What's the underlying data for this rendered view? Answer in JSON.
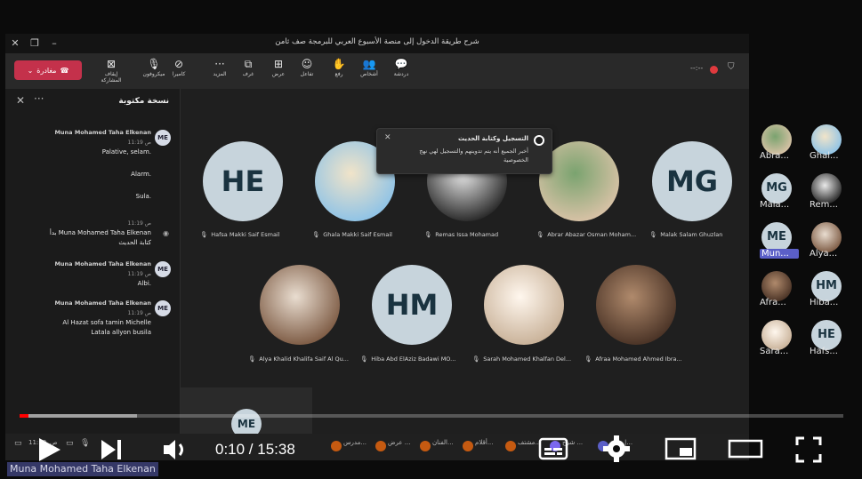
{
  "window": {
    "title": "شرح طريقة الدخول إلى منصة الأسبوع العربي للبرمجة صف ثامن"
  },
  "toolbar": {
    "leave_label": "مغادرة",
    "items": [
      {
        "label": "إيقاف المشاركة",
        "icon": "share-stop-icon"
      },
      {
        "label": "ميكروفون",
        "icon": "mic-icon"
      },
      {
        "label": "كاميرا",
        "icon": "camera-off-icon"
      },
      {
        "label": "المزيد",
        "icon": "more-icon"
      },
      {
        "label": "غرف",
        "icon": "rooms-icon"
      },
      {
        "label": "عرض",
        "icon": "view-icon"
      },
      {
        "label": "تفاعل",
        "icon": "react-icon"
      },
      {
        "label": "رفع",
        "icon": "raise-hand-icon"
      },
      {
        "label": "أشخاص",
        "icon": "people-icon"
      },
      {
        "label": "دردشة",
        "icon": "chat-icon"
      }
    ],
    "rec_indicator": "--:--"
  },
  "captions": {
    "title": "نسخة مكتوبة",
    "entries": [
      {
        "name": "Muna Mohamed Taha Elkenan",
        "time": "11:19 ص",
        "lines": [
          "Palative, selam.",
          "Alarm.",
          "Sula."
        ],
        "avatar": "ME"
      },
      {
        "system_time": "11:19 ص",
        "system_text_1": "بدأ Muna Mohamed Taha Elkenan",
        "system_text_2": "كتابة الحديث"
      },
      {
        "name": "Muna Mohamed Taha Elkenan",
        "time": "11:19 ص",
        "lines": [
          "Albi."
        ],
        "avatar": "ME"
      },
      {
        "name": "Muna Mohamed Taha Elkenan",
        "time": "11:19 ص",
        "lines": [
          "Al Hazat sofa tamin Michelle",
          "Latala allyon busila"
        ],
        "avatar": "ME"
      }
    ]
  },
  "popup": {
    "title": "التسجيل وكتابة الحديث",
    "body": "أخبر الجميع أنه يتم تدوينهم والتسجيل لهي نهج الخصوصية"
  },
  "participants_row1": [
    {
      "initials": "HE",
      "name": "Hafsa Makki Saif Esmail",
      "type": "initials"
    },
    {
      "initials": "",
      "name": "Ghala Makki Saif Esmail",
      "type": "photo",
      "colors": [
        "#8fc3e6",
        "#f1e4c9"
      ]
    },
    {
      "initials": "",
      "name": "Remas Issa Mohamad",
      "type": "photo",
      "colors": [
        "#2a2a2a",
        "#e9e9e9"
      ]
    },
    {
      "initials": "",
      "name": "Abrar Abazar Osman Moham...",
      "type": "photo",
      "colors": [
        "#d8c2a6",
        "#7aa36f"
      ]
    },
    {
      "initials": "MG",
      "name": "Malak Salam Ghuzlan",
      "type": "initials"
    }
  ],
  "participants_row2": [
    {
      "initials": "",
      "name": "Alya Khalid Khalifa Saif Al Qu...",
      "type": "photo",
      "colors": [
        "#7e5c45",
        "#e9ddd0"
      ]
    },
    {
      "initials": "HM",
      "name": "Hiba Abd ElAziz Badawi MO...",
      "type": "initials"
    },
    {
      "initials": "",
      "name": "Sarah Mohamed Khalfan Del...",
      "type": "photo",
      "colors": [
        "#c9b299",
        "#fff7ee"
      ]
    },
    {
      "initials": "",
      "name": "Afraa Mohamed Ahmed Ibra...",
      "type": "photo",
      "colors": [
        "#4a3326",
        "#b08a6c"
      ]
    }
  ],
  "self_tile": {
    "initials": "ME"
  },
  "side_participants": [
    {
      "label": "Abra...",
      "initials": "",
      "type": "photo",
      "colors": [
        "#d8c2a6",
        "#7aa36f"
      ]
    },
    {
      "label": "Ghal...",
      "initials": "",
      "type": "photo",
      "colors": [
        "#8fc3e6",
        "#f1e4c9"
      ]
    },
    {
      "label": "Mala...",
      "initials": "MG",
      "type": "initials"
    },
    {
      "label": "Rem...",
      "initials": "",
      "type": "photo",
      "colors": [
        "#2a2a2a",
        "#e9e9e9"
      ]
    },
    {
      "label": "Mun...",
      "initials": "ME",
      "type": "initials",
      "active": true
    },
    {
      "label": "Alya...",
      "initials": "",
      "type": "photo",
      "colors": [
        "#7e5c45",
        "#e9ddd0"
      ]
    },
    {
      "label": "Afra...",
      "initials": "",
      "type": "photo",
      "colors": [
        "#4a3326",
        "#b08a6c"
      ]
    },
    {
      "label": "Hiba...",
      "initials": "HM",
      "type": "initials"
    },
    {
      "label": "Sara...",
      "initials": "",
      "type": "photo",
      "colors": [
        "#c9b299",
        "#fff7ee"
      ]
    },
    {
      "label": "Hafs...",
      "initials": "HE",
      "type": "initials"
    }
  ],
  "taskbar": {
    "items": [
      "مدرس...",
      "عرض ...",
      "الفنان...",
      "أقلام...",
      "مشتف...",
      "شرح ...",
      "عامة |..."
    ],
    "tray_time": "11:19",
    "tray_date": "ص"
  },
  "caption_overlay": "Muna Mohamed Taha  Elkenan",
  "player": {
    "current_time": "0:10",
    "duration": "15:38",
    "time_display": "0:10 / 15:38",
    "played_fraction": 0.0107,
    "buffered_fraction": 0.143,
    "accent": "#ff0000"
  }
}
